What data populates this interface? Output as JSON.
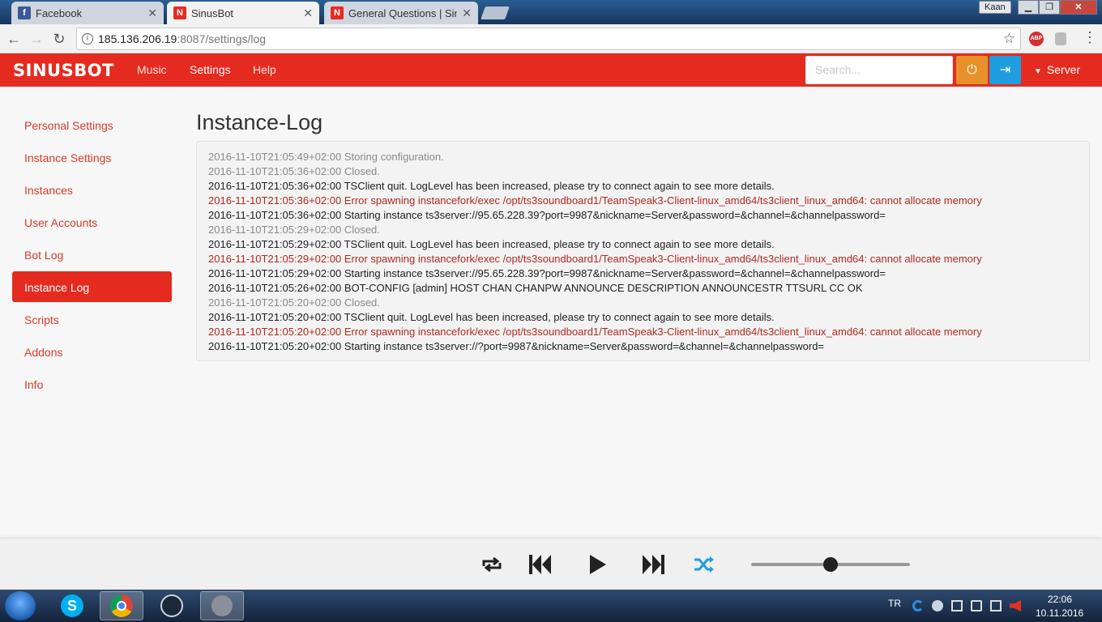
{
  "browser": {
    "tabs": [
      {
        "title": "Facebook",
        "icon": "facebook-icon"
      },
      {
        "title": "SinusBot",
        "icon": "sinusbot-icon"
      },
      {
        "title": "General Questions | Sinu",
        "icon": "sinusbot-icon"
      }
    ],
    "user": "Kaan",
    "url_host": "185.136.206.19",
    "url_rest": ":8087/settings/log",
    "extension": "ABP"
  },
  "app": {
    "brand": "SINUSBOT",
    "nav": [
      "Music",
      "Settings",
      "Help"
    ],
    "search_placeholder": "Search...",
    "server_label": "Server",
    "accent": "#e52b20"
  },
  "sidebar": {
    "items": [
      "Personal Settings",
      "Instance Settings",
      "Instances",
      "User Accounts",
      "Bot Log",
      "Instance Log",
      "Scripts",
      "Addons",
      "Info"
    ],
    "active": "Instance Log"
  },
  "page": {
    "title": "Instance-Log",
    "log": [
      {
        "level": "debug",
        "text": "2016-11-10T21:05:49+02:00 Storing configuration."
      },
      {
        "level": "debug",
        "text": "2016-11-10T21:05:36+02:00 Closed."
      },
      {
        "level": "info",
        "text": "2016-11-10T21:05:36+02:00 TSClient quit. LogLevel has been increased, please try to connect again to see more details."
      },
      {
        "level": "error",
        "text": "2016-11-10T21:05:36+02:00 Error spawning instancefork/exec /opt/ts3soundboard1/TeamSpeak3-Client-linux_amd64/ts3client_linux_amd64: cannot allocate memory"
      },
      {
        "level": "info",
        "text": "2016-11-10T21:05:36+02:00 Starting instance ts3server://95.65.228.39?port=9987&nickname=Server&password=&channel=&channelpassword="
      },
      {
        "level": "debug",
        "text": "2016-11-10T21:05:29+02:00 Closed."
      },
      {
        "level": "info",
        "text": "2016-11-10T21:05:29+02:00 TSClient quit. LogLevel has been increased, please try to connect again to see more details."
      },
      {
        "level": "error",
        "text": "2016-11-10T21:05:29+02:00 Error spawning instancefork/exec /opt/ts3soundboard1/TeamSpeak3-Client-linux_amd64/ts3client_linux_amd64: cannot allocate memory"
      },
      {
        "level": "info",
        "text": "2016-11-10T21:05:29+02:00 Starting instance ts3server://95.65.228.39?port=9987&nickname=Server&password=&channel=&channelpassword="
      },
      {
        "level": "info",
        "text": "2016-11-10T21:05:26+02:00 BOT-CONFIG [admin] HOST CHAN CHANPW ANNOUNCE DESCRIPTION ANNOUNCESTR TTSURL CC OK"
      },
      {
        "level": "debug",
        "text": "2016-11-10T21:05:20+02:00 Closed."
      },
      {
        "level": "info",
        "text": "2016-11-10T21:05:20+02:00 TSClient quit. LogLevel has been increased, please try to connect again to see more details."
      },
      {
        "level": "error",
        "text": "2016-11-10T21:05:20+02:00 Error spawning instancefork/exec /opt/ts3soundboard1/TeamSpeak3-Client-linux_amd64/ts3client_linux_amd64: cannot allocate memory"
      },
      {
        "level": "info",
        "text": "2016-11-10T21:05:20+02:00 Starting instance ts3server://?port=9987&nickname=Server&password=&channel=&channelpassword="
      }
    ]
  },
  "player": {
    "volume_fraction": 0.5
  },
  "taskbar": {
    "lang": "TR",
    "time": "22:06",
    "date": "10.11.2016"
  }
}
